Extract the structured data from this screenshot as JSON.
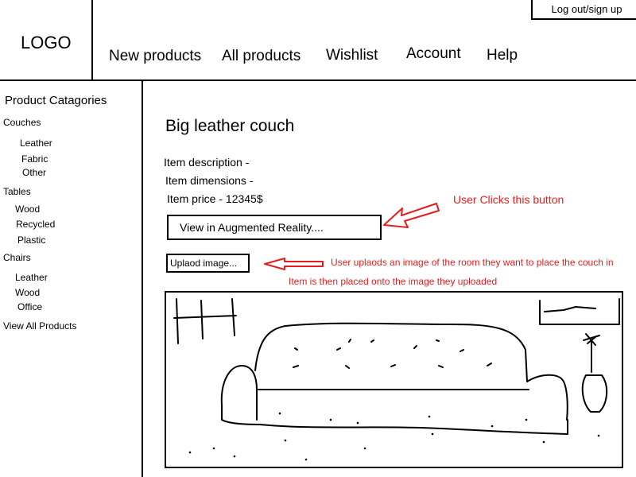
{
  "header": {
    "logo": "LOGO",
    "nav": [
      "New products",
      "All products",
      "Wishlist",
      "Account",
      "Help"
    ],
    "auth_label": "Log out/sign up"
  },
  "sidebar": {
    "title": "Product Catagories",
    "groups": [
      {
        "label": "Couches",
        "items": [
          "Leather",
          "Fabric",
          "Other"
        ]
      },
      {
        "label": "Tables",
        "items": [
          "Wood",
          "Recycled",
          "Plastic"
        ]
      },
      {
        "label": "Chairs",
        "items": [
          "Leather",
          "Wood",
          "Office"
        ]
      }
    ],
    "view_all": "View All Products"
  },
  "product": {
    "title": "Big leather couch",
    "description_label": "Item description -",
    "dimensions_label": "Item dimensions -",
    "price_label": "Item price - 12345$",
    "ar_button": "View in Augmented Reality....",
    "upload_button": "Uplaod image..."
  },
  "annotations": {
    "ar_note": "User Clicks this button",
    "upload_note": "User uplaods an image of the room they want to place the couch in",
    "placed_note": "Item is then placed onto the image they uploaded",
    "color": "#e02020"
  }
}
